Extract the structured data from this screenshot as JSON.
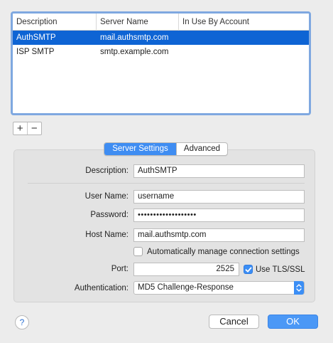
{
  "table": {
    "columns": [
      "Description",
      "Server Name",
      "In Use By Account"
    ],
    "rows": [
      {
        "description": "AuthSMTP",
        "server": "mail.authsmtp.com",
        "in_use": "",
        "selected": true
      },
      {
        "description": "ISP SMTP",
        "server": "smtp.example.com",
        "in_use": "",
        "selected": false
      }
    ]
  },
  "list_buttons": {
    "add": "+",
    "remove": "−"
  },
  "tabs": [
    "Server Settings",
    "Advanced"
  ],
  "form": {
    "description_label": "Description:",
    "description_value": "AuthSMTP",
    "username_label": "User Name:",
    "username_value": "username",
    "password_label": "Password:",
    "password_value": "•••••••••••••••••••",
    "hostname_label": "Host Name:",
    "hostname_value": "mail.authsmtp.com",
    "auto_manage_label": "Automatically manage connection settings",
    "auto_manage_checked": false,
    "port_label": "Port:",
    "port_value": "2525",
    "tls_label": "Use TLS/SSL",
    "tls_checked": true,
    "auth_label": "Authentication:",
    "auth_value": "MD5 Challenge-Response"
  },
  "footer": {
    "help": "?",
    "cancel": "Cancel",
    "ok": "OK"
  },
  "colors": {
    "selection": "#0e64d4",
    "accent": "#3f8df2",
    "table_focus_ring": "#7fa8e0"
  }
}
